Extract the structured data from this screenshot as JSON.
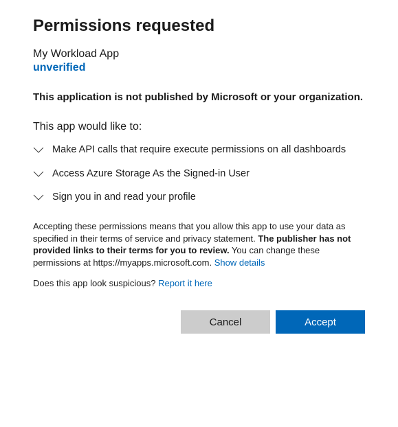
{
  "title": "Permissions requested",
  "app": {
    "name": "My Workload App",
    "verification": "unverified"
  },
  "warning": "This application is not published by Microsoft or your organization.",
  "intro": "This app would like to:",
  "permissions": [
    "Make API calls that require execute permissions on all dashboards",
    "Access Azure Storage As the Signed-in User",
    "Sign you in and read your profile"
  ],
  "disclosure": {
    "pre": "Accepting these permissions means that you allow this app to use your data as specified in their terms of service and privacy statement. ",
    "bold": "The publisher has not provided links to their terms for you to review.",
    "post": " You can change these permissions at https://myapps.microsoft.com. ",
    "link": "Show details"
  },
  "suspicious": {
    "text": "Does this app look suspicious? ",
    "link": "Report it here"
  },
  "buttons": {
    "cancel": "Cancel",
    "accept": "Accept"
  }
}
